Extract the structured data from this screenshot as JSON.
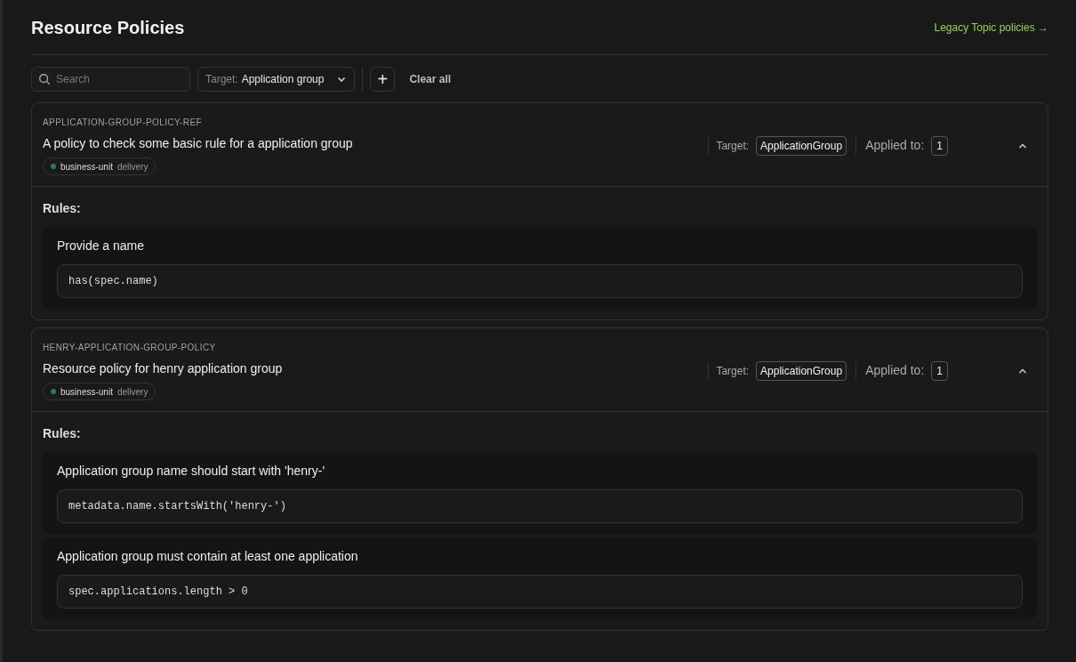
{
  "header": {
    "title": "Resource Policies",
    "link": "Legacy Topic policies →"
  },
  "toolbar": {
    "search": {
      "placeholder": "Search"
    },
    "target_filter": {
      "label": "Target:",
      "value": "Application group"
    },
    "add_button": "+",
    "clear_button": "Clear all"
  },
  "policies": [
    {
      "id": "APPLICATION-GROUP-POLICY-REF",
      "description": "A policy to check some basic rule for a application group",
      "labels": [
        {
          "key": "business-unit",
          "value": "delivery",
          "color": "#2f7a5f"
        }
      ],
      "target_label": "Target:",
      "target": "ApplicationGroup",
      "applied_label": "Applied to:",
      "applied_count": "1",
      "expanded": true,
      "rules_label": "Rules:",
      "rules": [
        {
          "name": "Provide a name",
          "expression": "has(spec.name)"
        }
      ]
    },
    {
      "id": "HENRY-APPLICATION-GROUP-POLICY",
      "description": "Resource policy for henry application group",
      "labels": [
        {
          "key": "business-unit",
          "value": "delivery",
          "color": "#2f7a5f"
        }
      ],
      "target_label": "Target:",
      "target": "ApplicationGroup",
      "applied_label": "Applied to:",
      "applied_count": "1",
      "expanded": true,
      "rules_label": "Rules:",
      "rules": [
        {
          "name": "Application group name should start with 'henry-'",
          "expression": "metadata.name.startsWith('henry-')"
        },
        {
          "name": "Application group must contain at least one application",
          "expression": "spec.applications.length > 0"
        }
      ]
    }
  ]
}
